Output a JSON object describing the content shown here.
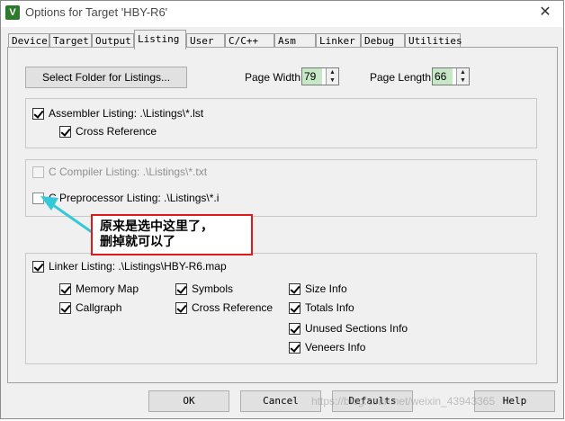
{
  "window": {
    "title": "Options for Target 'HBY-R6'",
    "icon_glyph": "V",
    "close_glyph": "✕"
  },
  "tabs": [
    {
      "label": "Device"
    },
    {
      "label": "Target"
    },
    {
      "label": "Output"
    },
    {
      "label": "Listing",
      "active": true
    },
    {
      "label": "User"
    },
    {
      "label": "C/C++"
    },
    {
      "label": "Asm"
    },
    {
      "label": "Linker"
    },
    {
      "label": "Debug"
    },
    {
      "label": "Utilities"
    }
  ],
  "top": {
    "select_folder_label": "Select Folder for Listings...",
    "page_width_label": "Page Width:",
    "page_width_value": "79",
    "page_length_label": "Page Length:",
    "page_length_value": "66"
  },
  "assembler": {
    "listing_label": "Assembler Listing:  .\\Listings\\*.lst",
    "listing_checked": true,
    "cross_ref_label": "Cross Reference",
    "cross_ref_checked": true
  },
  "compiler": {
    "c_compiler_label": "C Compiler Listing:  .\\Listings\\*.txt",
    "c_compiler_checked": false,
    "preprocessor_label": "C Preprocessor Listing:  .\\Listings\\*.i",
    "preprocessor_checked": false
  },
  "annotation": {
    "line1": "原来是选中这里了，",
    "line2": "删掉就可以了",
    "border_color": "#e01a1a",
    "arrow_color": "#35c8d8"
  },
  "linker": {
    "listing_label": "Linker Listing:  .\\Listings\\HBY-R6.map",
    "listing_checked": true,
    "options": {
      "memory_map": "Memory Map",
      "symbols": "Symbols",
      "size_info": "Size Info",
      "callgraph": "Callgraph",
      "cross_reference": "Cross Reference",
      "totals_info": "Totals Info",
      "unused_sections_info": "Unused Sections Info",
      "veneers_info": "Veneers Info"
    }
  },
  "buttons": {
    "ok": "OK",
    "cancel": "Cancel",
    "defaults": "Defaults",
    "help": "Help"
  },
  "watermark": "https://blog.csdn.net/weixin_43943365"
}
